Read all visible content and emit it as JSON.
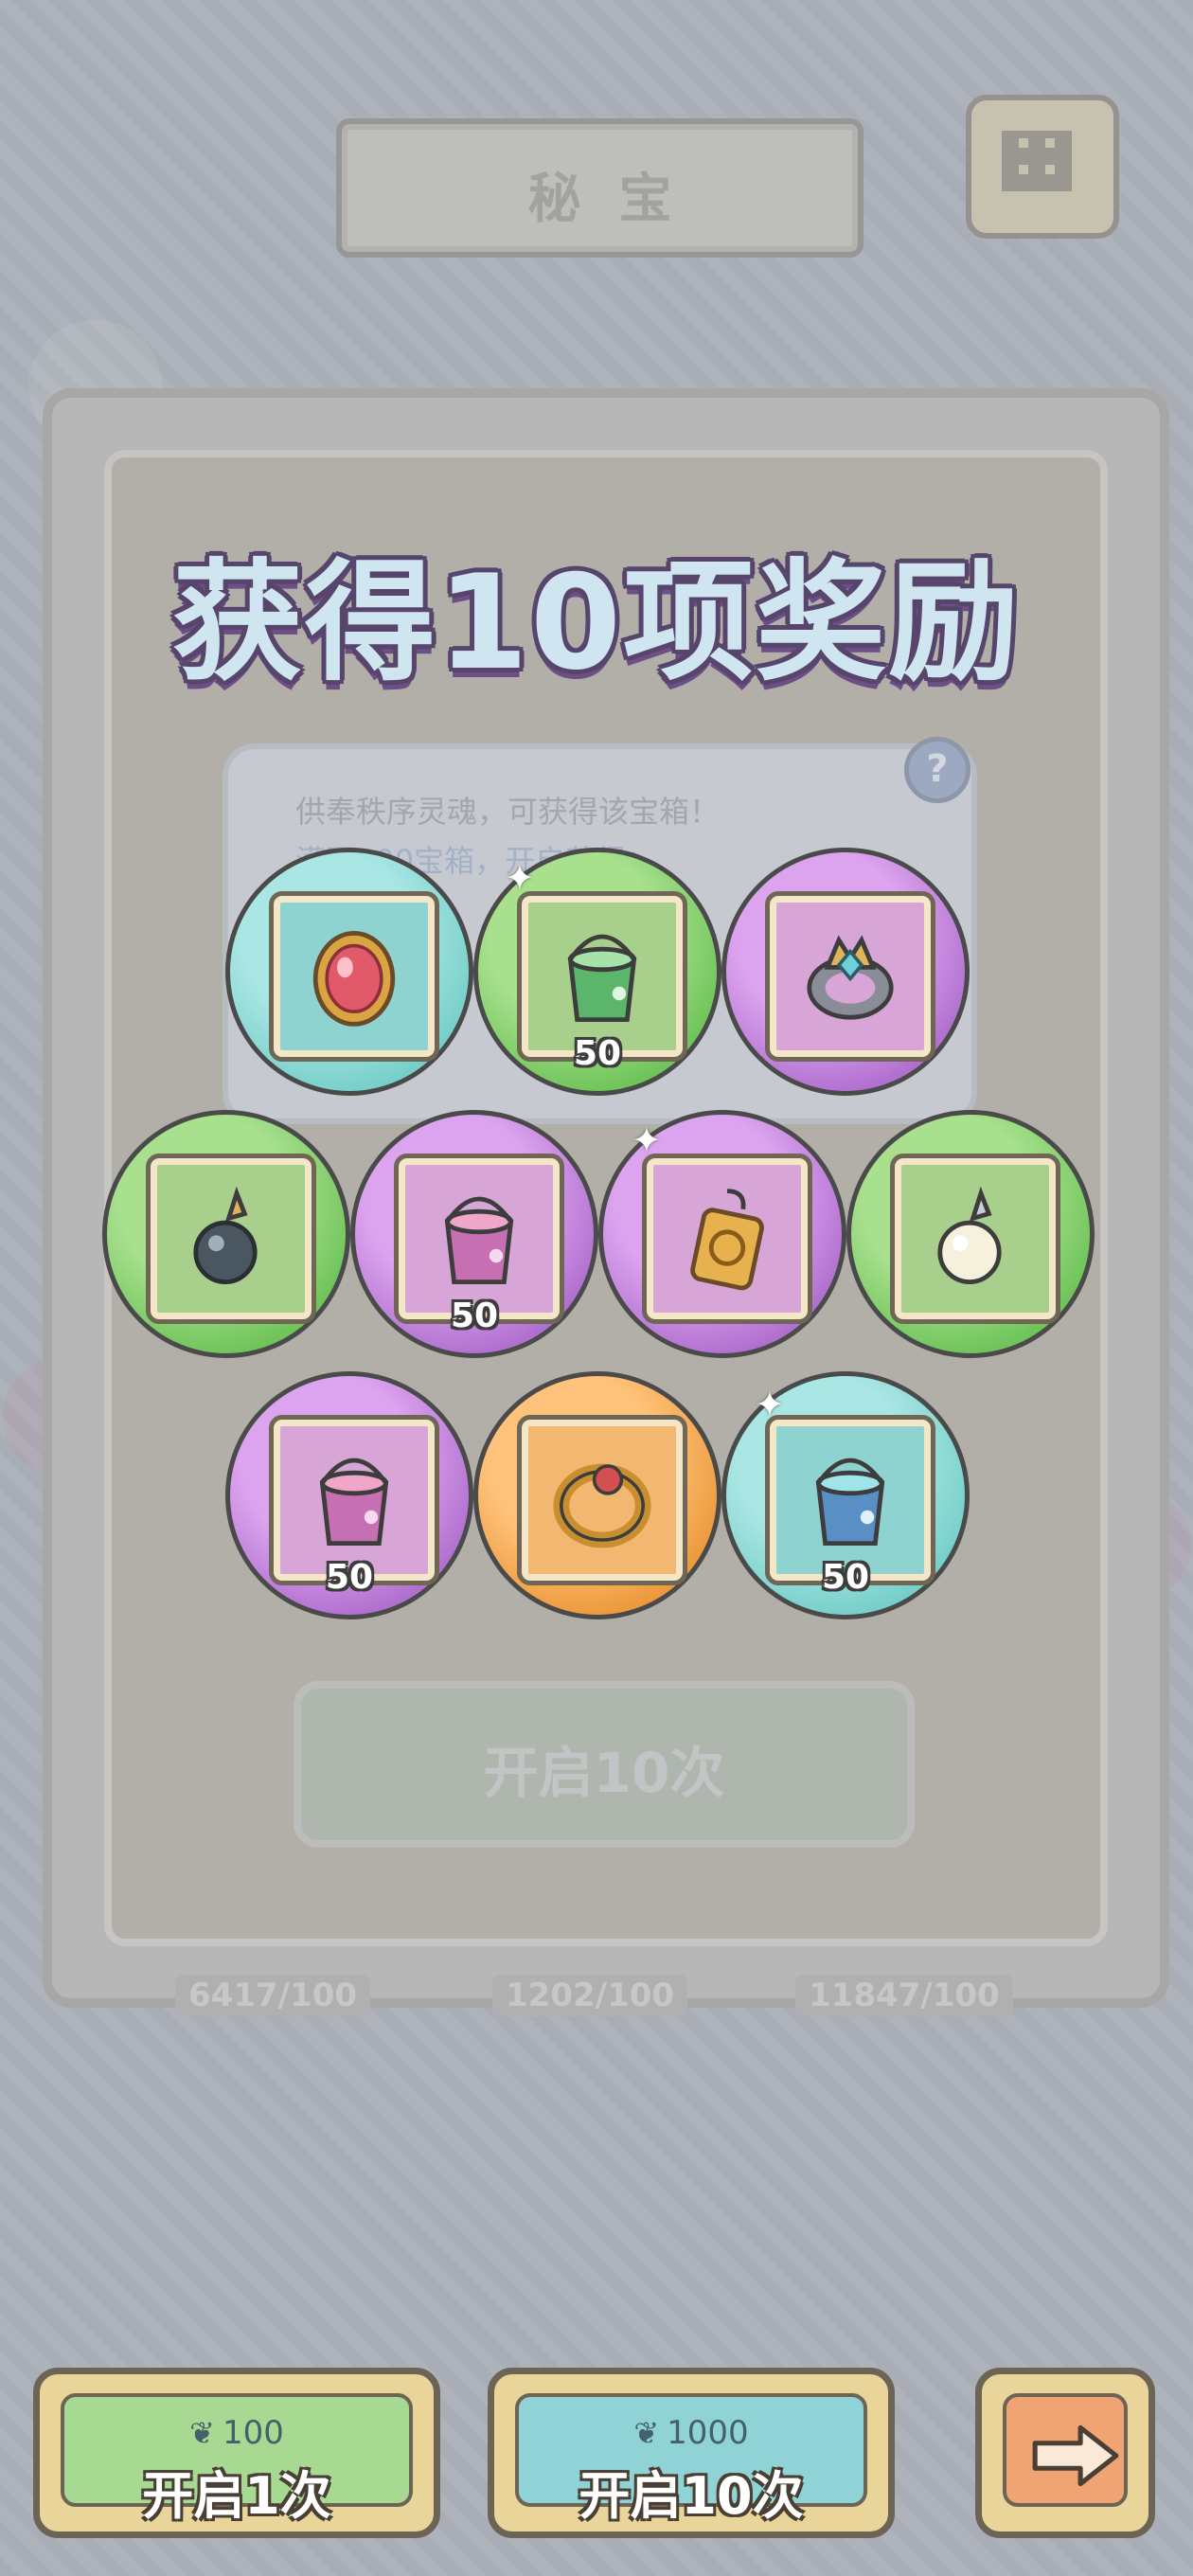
{
  "header": {
    "title": "秘宝"
  },
  "overlay": {
    "headline": "获得10项奖励"
  },
  "background_panel": {
    "info_line1": "供奉秩序灵魂，可获得该宝箱！",
    "info_line2": "满百100宝箱，开启获得：",
    "open10_label": "开启10次",
    "stats": [
      "6417/100",
      "1202/100",
      "11847/100"
    ]
  },
  "rewards": [
    {
      "row": 1,
      "color": "cyan",
      "item": "ruby-pendant-icon",
      "qty": ""
    },
    {
      "row": 1,
      "color": "green",
      "item": "green-paint-bucket-icon",
      "qty": "50"
    },
    {
      "row": 1,
      "color": "purple",
      "item": "jeweled-crown-ring-icon",
      "qty": ""
    },
    {
      "row": 2,
      "color": "green",
      "item": "black-pearl-earring-icon",
      "qty": ""
    },
    {
      "row": 2,
      "color": "purple",
      "item": "pink-paint-bucket-icon",
      "qty": "50"
    },
    {
      "row": 2,
      "color": "purple",
      "item": "gold-amulet-icon",
      "qty": ""
    },
    {
      "row": 2,
      "color": "green",
      "item": "white-pearl-earring-icon",
      "qty": ""
    },
    {
      "row": 3,
      "color": "purple",
      "item": "pink-paint-bucket-icon",
      "qty": "50"
    },
    {
      "row": 3,
      "color": "orange",
      "item": "gold-ruby-ring-icon",
      "qty": ""
    },
    {
      "row": 3,
      "color": "cyan",
      "item": "blue-paint-bucket-icon",
      "qty": "50"
    }
  ],
  "buttons": {
    "open1": {
      "cost": "100",
      "label": "开启1次"
    },
    "open10": {
      "cost": "1000",
      "label": "开启10次"
    },
    "next": {
      "icon": "arrow-right-icon"
    }
  },
  "colors": {
    "cyan": "#78cfc9",
    "green": "#6fc45a",
    "purple": "#b170cf",
    "orange": "#ec9a3c"
  }
}
